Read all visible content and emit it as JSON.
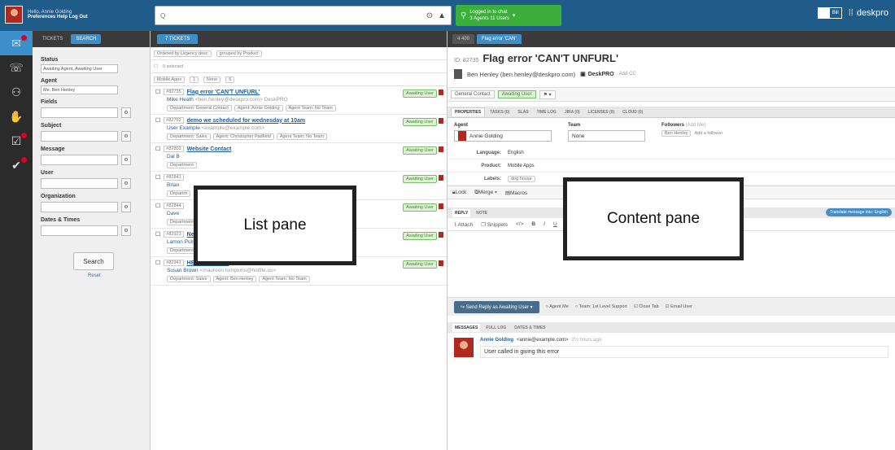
{
  "topbar": {
    "greeting": "Hello, Annie Golding",
    "links": "Preferences   Help   Log Out",
    "search_placeholder": "Q",
    "chat_line1": "Logged in to chat",
    "chat_line2": "3 Agents   11 Users",
    "toggle_a": "",
    "toggle_b": "Bill",
    "brand": "deskpro"
  },
  "iconbar": {
    "items": [
      "tickets",
      "chat",
      "people",
      "feedback",
      "tasks",
      "deals"
    ]
  },
  "filter": {
    "tab_tickets": "TICKETS",
    "tab_search": "SEARCH",
    "status_label": "Status",
    "status_value": "Awaiting Agent, Awaiting User",
    "agent_label": "Agent",
    "agent_value": "Me, Ben Henley",
    "fields_label": "Fields",
    "subject_label": "Subject",
    "message_label": "Message",
    "user_label": "User",
    "organization_label": "Organization",
    "dates_label": "Dates & Times",
    "search_button": "Search",
    "reset_link": "Reset"
  },
  "list": {
    "tab_label": "7 TICKETS",
    "ordered_by": "Ordered by  Urgency  desc",
    "grouped_by": "grouped by  Product",
    "selected": "0 selected",
    "group_name": "Mobile Apps",
    "group_count": "1",
    "group_none": "None",
    "group_none_count": "6",
    "tickets": [
      {
        "id": "#82735",
        "subject": "Flag error 'CAN'T UNFURL'",
        "user": "Mike Heath",
        "email": "<ben.henley@deskpro.com> DeskPRO",
        "meta": [
          "Department: General Contact",
          "Agent: Annie Golding",
          "Agent Team: No Team"
        ],
        "status": "Awaiting User"
      },
      {
        "id": "#82792",
        "subject": "demo we scheduled for wednesday at 10am",
        "user": "User Example",
        "email": "<example@example.com>",
        "meta": [
          "Department: Sales",
          "Agent: Christopher Padfield",
          "Agent Team: No Team"
        ],
        "status": "Awaiting User"
      },
      {
        "id": "#82803",
        "subject": "Website Contact",
        "user": "Dal B",
        "email": "",
        "meta": [
          "Department"
        ],
        "status": "Awaiting User"
      },
      {
        "id": "#82841",
        "subject": "",
        "user": "Brian",
        "email": "",
        "meta": [
          "Departm"
        ],
        "status": "Awaiting User"
      },
      {
        "id": "#82844",
        "subject": "",
        "user": "Dave",
        "email": "",
        "meta": [
          "Department"
        ],
        "status": "Awaiting User"
      },
      {
        "id": "#82923",
        "subject": "New message from customer",
        "user": "Lamon Pulmer",
        "email": "",
        "meta": [
          "Department: Support",
          "Agent: Christopher Padfield",
          "Agent Team: No Team"
        ],
        "status": "Awaiting User"
      },
      {
        "id": "#82941",
        "subject": "HEEEELPPPPP",
        "user": "Susan Brown",
        "email": "<maureen.tompkins@hotfile.us>",
        "meta": [
          "Department: Sales",
          "Agent: Ben Henley",
          "Agent Team: No Team"
        ],
        "status": "Awaiting User"
      }
    ]
  },
  "content": {
    "tab_back": "4 400",
    "tab_ticket": "Flag error 'CAN'",
    "ticket_id": "ID: 82735",
    "title": "Flag error 'CAN'T UNFURL'",
    "person": "Ben Henley (ben.henley@deskpro.com)",
    "organization": "DeskPRO",
    "add_cc": "Add CC",
    "department": "General Contact",
    "status": "Awaiting User",
    "prop_tabs": [
      "PROPERTIES",
      "TASKS (0)",
      "SLAS",
      "TIME LOG",
      "JIRA (0)",
      "LICENSES (0)",
      "CLOUD (0)"
    ],
    "agent_label": "Agent",
    "agent_value": "Annie Golding",
    "team_label": "Team",
    "team_value": "None",
    "followers_label": "Followers",
    "followers_hint": "(Add Me)",
    "follower": "Ben Henley",
    "add_follower": "Add a follower",
    "language_key": "Language:",
    "language_val": "English",
    "product_key": "Product:",
    "product_val": "Mobile Apps",
    "labels_key": "Labels:",
    "labels_val": "dog house",
    "lock": "Lock",
    "merge": "Merge",
    "macros": "Macros",
    "reply_tab": "REPLY",
    "note_tab": "NOTE",
    "translate": "Translate message into: English",
    "attach": "Attach",
    "snippets": "Snippets",
    "send_button": "Send Reply as Awaiting User",
    "agent_opt": "Agent",
    "me_opt": "Me",
    "team_opt": "Team: 1st Level Support",
    "close_tab": "Close Tab",
    "email_user": "Email User",
    "msg_tabs": [
      "MESSAGES",
      "FULL LOG",
      "DATES & TIMES"
    ],
    "msg_author": "Annie Golding",
    "msg_email": "<annie@example.com>",
    "msg_time": "2½ hours ago",
    "msg_body": "User called in giving this error"
  },
  "overlays": {
    "list": "List pane",
    "content": "Content pane"
  }
}
